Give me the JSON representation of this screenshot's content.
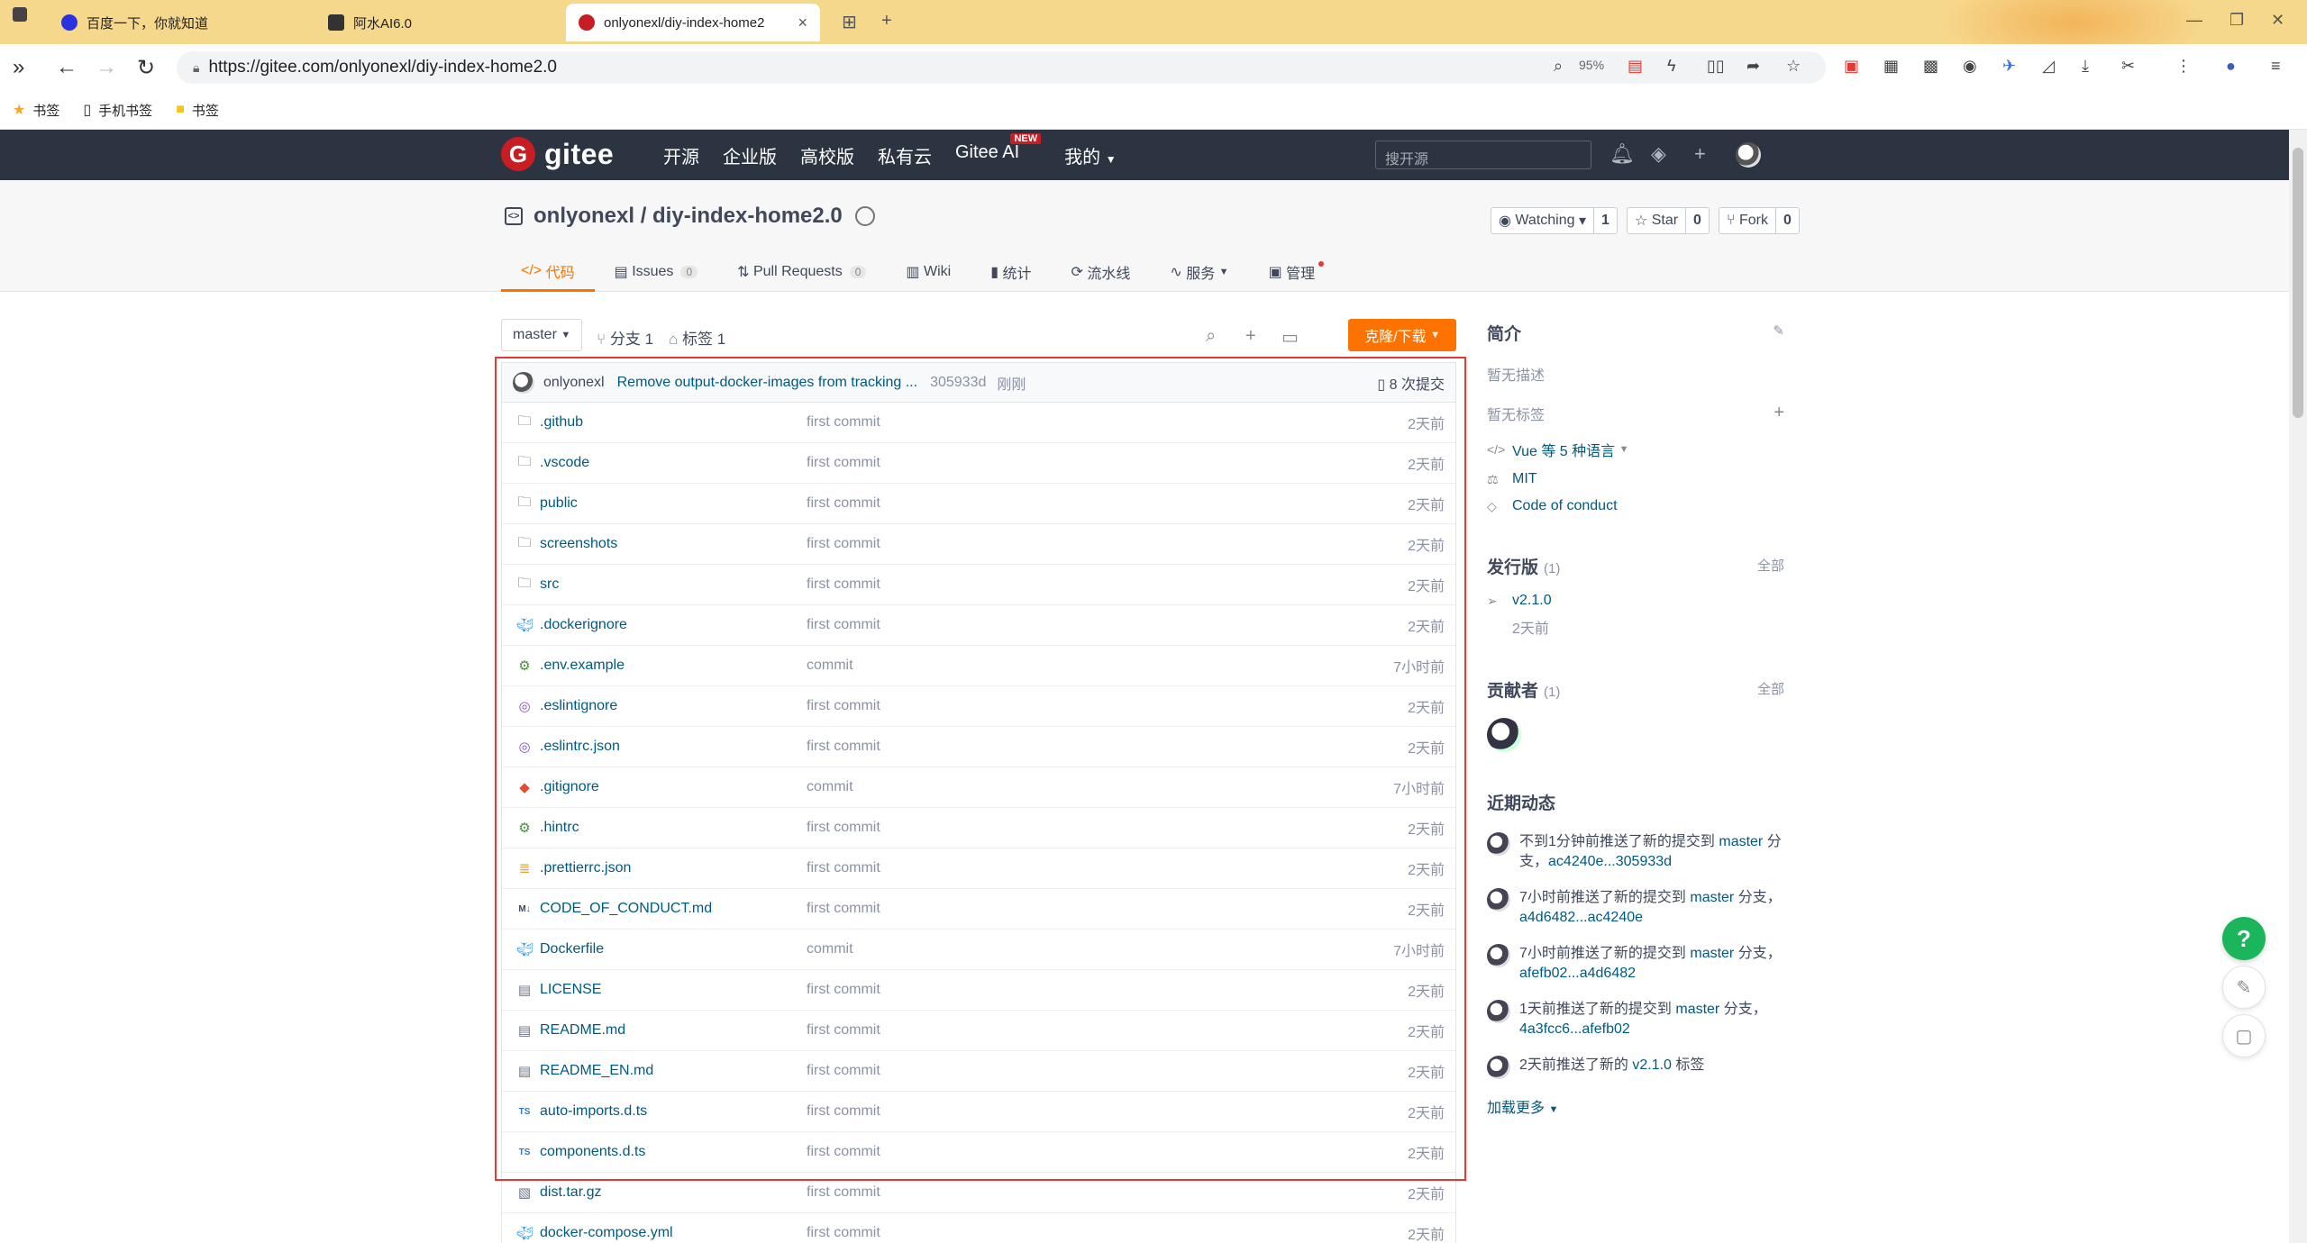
{
  "browser": {
    "tabs": [
      {
        "title": "百度一下，你就知道",
        "fav_color": "#2932e1"
      },
      {
        "title": "阿水AI6.0",
        "fav_color": "#333333"
      },
      {
        "title": "onlyonexl/diy-index-home2",
        "fav_color": "#c71d23"
      }
    ],
    "url": "https://gitee.com/onlyonexl/diy-index-home2.0",
    "zoom": "95%",
    "bookmarks": [
      "书签",
      "手机书签",
      "书签"
    ]
  },
  "gitee": {
    "logo_text": "gitee",
    "nav": [
      "开源",
      "企业版",
      "高校版",
      "私有云",
      "Gitee AI",
      "我的"
    ],
    "new_badge": "NEW",
    "search_placeholder": "搜开源"
  },
  "project": {
    "title": "onlyonexl / diy-index-home2.0",
    "watch_label": "Watching",
    "watch_count": "1",
    "star_label": "Star",
    "star_count": "0",
    "fork_label": "Fork",
    "fork_count": "0",
    "tabs": [
      {
        "label": "代码",
        "icon": "</>"
      },
      {
        "label": "Issues",
        "icon": "▤",
        "count": "0"
      },
      {
        "label": "Pull Requests",
        "icon": "⇅",
        "count": "0"
      },
      {
        "label": "Wiki",
        "icon": "▥"
      },
      {
        "label": "统计",
        "icon": "▮"
      },
      {
        "label": "流水线",
        "icon": "⟳"
      },
      {
        "label": "服务",
        "icon": "∿"
      },
      {
        "label": "管理",
        "icon": "▣"
      }
    ]
  },
  "toolbar": {
    "branch": "master",
    "branches": "分支 1",
    "tags": "标签 1",
    "clone": "克隆/下载"
  },
  "commit": {
    "author": "onlyonexl",
    "message": "Remove output-docker-images from tracking ...",
    "sha": "305933d",
    "time": "刚刚",
    "count": "8 次提交"
  },
  "files": [
    {
      "name": ".github",
      "icon": "folder",
      "msg": "first commit",
      "time": "2天前"
    },
    {
      "name": ".vscode",
      "icon": "folder",
      "msg": "first commit",
      "time": "2天前"
    },
    {
      "name": "public",
      "icon": "folder",
      "msg": "first commit",
      "time": "2天前"
    },
    {
      "name": "screenshots",
      "icon": "folder",
      "msg": "first commit",
      "time": "2天前"
    },
    {
      "name": "src",
      "icon": "folder",
      "msg": "first commit",
      "time": "2天前"
    },
    {
      "name": ".dockerignore",
      "icon": "docker",
      "msg": "first commit",
      "time": "2天前"
    },
    {
      "name": ".env.example",
      "icon": "gear",
      "msg": "commit",
      "time": "7小时前"
    },
    {
      "name": ".eslintignore",
      "icon": "eslint",
      "msg": "first commit",
      "time": "2天前"
    },
    {
      "name": ".eslintrc.json",
      "icon": "eslint",
      "msg": "first commit",
      "time": "2天前"
    },
    {
      "name": ".gitignore",
      "icon": "git",
      "msg": "commit",
      "time": "7小时前"
    },
    {
      "name": ".hintrc",
      "icon": "gear",
      "msg": "first commit",
      "time": "2天前"
    },
    {
      "name": ".prettierrc.json",
      "icon": "prettier",
      "msg": "first commit",
      "time": "2天前"
    },
    {
      "name": "CODE_OF_CONDUCT.md",
      "icon": "markdown",
      "msg": "first commit",
      "time": "2天前"
    },
    {
      "name": "Dockerfile",
      "icon": "docker",
      "msg": "commit",
      "time": "7小时前"
    },
    {
      "name": "LICENSE",
      "icon": "doc",
      "msg": "first commit",
      "time": "2天前"
    },
    {
      "name": "README.md",
      "icon": "doc",
      "msg": "first commit",
      "time": "2天前"
    },
    {
      "name": "README_EN.md",
      "icon": "doc",
      "msg": "first commit",
      "time": "2天前"
    },
    {
      "name": "auto-imports.d.ts",
      "icon": "ts",
      "msg": "first commit",
      "time": "2天前"
    },
    {
      "name": "components.d.ts",
      "icon": "ts",
      "msg": "first commit",
      "time": "2天前"
    },
    {
      "name": "dist.tar.gz",
      "icon": "archive",
      "msg": "first commit",
      "time": "2天前"
    },
    {
      "name": "docker-compose.yml",
      "icon": "docker",
      "msg": "first commit",
      "time": "2天前"
    }
  ],
  "sidebar": {
    "intro_title": "简介",
    "no_desc": "暂无描述",
    "no_tags": "暂无标签",
    "language": "Vue 等 5 种语言",
    "license": "MIT",
    "coc": "Code of conduct",
    "releases_title": "发行版",
    "releases_count": "(1)",
    "all": "全部",
    "release_tag": "v2.1.0",
    "release_time": "2天前",
    "contrib_title": "贡献者",
    "contrib_count": "(1)",
    "activity_title": "近期动态",
    "activities": [
      {
        "text": "不到1分钟前推送了新的提交到 ",
        "branch": "master",
        "rest": " 分支，",
        "range": "ac4240e...305933d"
      },
      {
        "text": "7小时前推送了新的提交到 ",
        "branch": "master",
        "rest": " 分支，",
        "range": "a4d6482...ac4240e"
      },
      {
        "text": "7小时前推送了新的提交到 ",
        "branch": "master",
        "rest": " 分支，",
        "range": "afefb02...a4d6482"
      },
      {
        "text": "1天前推送了新的提交到 ",
        "branch": "master",
        "rest": " 分支，",
        "range": "4a3fcc6...afefb02"
      },
      {
        "text": "2天前推送了新的 ",
        "branch": "v2.1.0",
        "rest": " 标签",
        "range": ""
      }
    ],
    "load_more": "加载更多"
  },
  "colors": {
    "accent": "#fe7300",
    "link": "#005980",
    "header_bg": "#2b3440",
    "highlight_box": "#e53935"
  }
}
